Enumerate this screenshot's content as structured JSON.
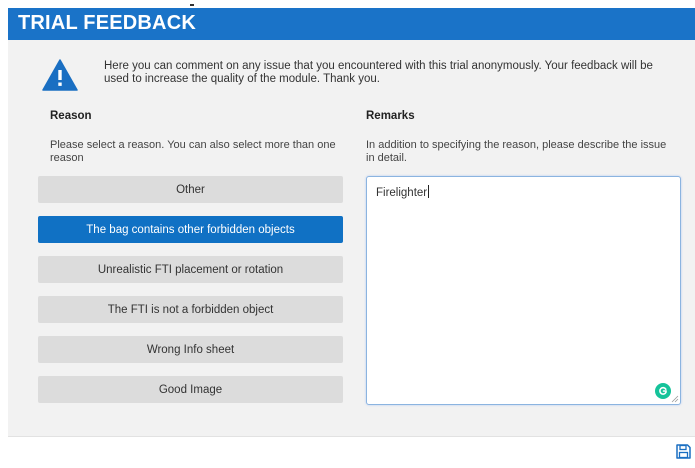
{
  "header": {
    "title": "TRIAL FEEDBACK"
  },
  "info": {
    "text": "Here you can comment on any issue that you encountered with this trial anonymously. Your feedback will be used to increase the quality of the module. Thank you."
  },
  "reason": {
    "heading": "Reason",
    "description": "Please select a reason. You can also select more than one reason",
    "options": [
      {
        "label": "Other",
        "selected": false
      },
      {
        "label": "The bag contains other forbidden objects",
        "selected": true
      },
      {
        "label": "Unrealistic FTI placement or rotation",
        "selected": false
      },
      {
        "label": "The FTI is not a forbidden object",
        "selected": false
      },
      {
        "label": "Wrong Info sheet",
        "selected": false
      },
      {
        "label": "Good Image",
        "selected": false
      }
    ]
  },
  "remarks": {
    "heading": "Remarks",
    "description": "In addition to specifying the reason, please describe the issue in detail.",
    "value": "Firelighter"
  },
  "icons": {
    "warning": "warning-icon",
    "grammarly": "grammarly-icon",
    "save": "save-icon"
  },
  "colors": {
    "accent": "#1a73c8",
    "selected": "#1071c4",
    "option_bg": "#dcdcdc",
    "panel_bg": "#f2f2f2"
  }
}
